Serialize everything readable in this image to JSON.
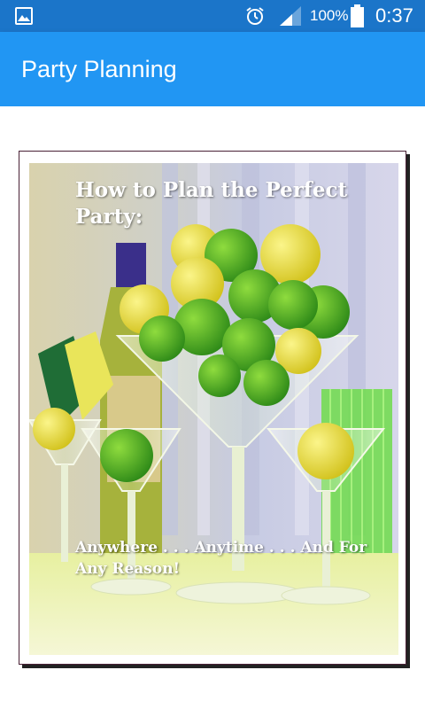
{
  "status_bar": {
    "battery_percent": "100%",
    "time": "0:37",
    "icons": [
      "gallery-icon",
      "alarm-icon",
      "signal-icon",
      "battery-icon"
    ]
  },
  "app_bar": {
    "title": "Party Planning"
  },
  "book_cover": {
    "title": "How to Plan the Perfect Party:",
    "subtitle": "Anywhere . . . Anytime . . . And For Any Reason!"
  },
  "colors": {
    "status_bar": "#1b75c9",
    "app_bar": "#2196f3",
    "frame_border": "#4a2136"
  }
}
